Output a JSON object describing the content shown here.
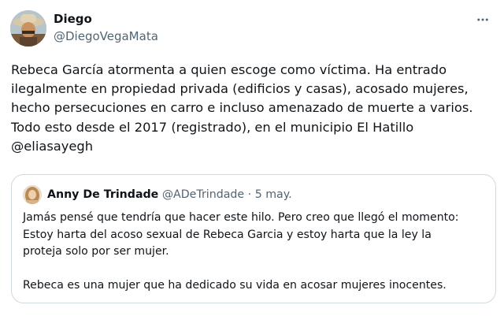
{
  "author": {
    "display_name": "Diego",
    "handle": "@DiegoVegaMata"
  },
  "tweet_lines": [
    "Rebeca García atormenta a quien escoge como víctima. Ha entrado",
    "ilegalmente en propiedad privada (edificios y casas), acosado mujeres,",
    "hecho persecuciones en carro e incluso amenazado de muerte a varios.",
    "Todo esto desde el 2017 (registrado), en el municipio El Hatillo",
    "@eliasayegh"
  ],
  "quoted": {
    "display_name": "Anny De Trindade",
    "handle": "@ADeTrindade",
    "separator": "·",
    "date": "5 may.",
    "lines": [
      "Jamás pensé que tendría que hacer este hilo. Pero creo que llegó el momento:",
      "Estoy harta del acoso sexual de Rebeca Garcia y estoy harta que la ley la",
      "proteja solo por ser mujer.",
      "",
      "Rebeca es una mujer que ha dedicado su vida en acosar mujeres inocentes."
    ]
  },
  "icons": {
    "more": "more-horizontal-icon"
  }
}
